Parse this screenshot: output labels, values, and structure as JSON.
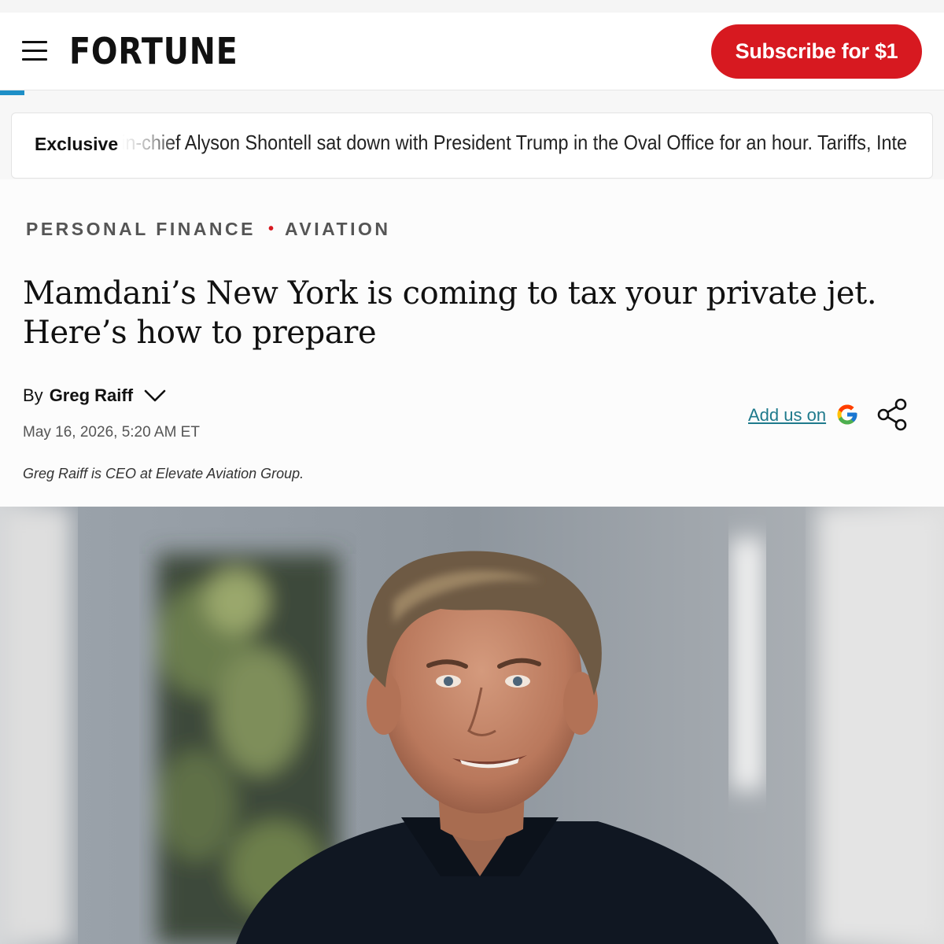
{
  "header": {
    "logo": "FORTUNE",
    "subscribe_label": "Subscribe for $1"
  },
  "ticker": {
    "label": "Exclusive",
    "text": "Editor-in-chief Alyson Shontell sat down with President Trump in the Oval Office for an hour. Tariffs, Inte"
  },
  "article": {
    "categories": [
      "PERSONAL FINANCE",
      "AVIATION"
    ],
    "headline": "Mamdani’s New York is coming to tax your private jet. Here’s how to prepare",
    "byline_prefix": "By",
    "author": "Greg Raiff",
    "date": "May 16, 2026, 5:20 AM ET",
    "bio": "Greg Raiff is CEO at Elevate Aviation Group.",
    "add_us_label": "Add us on"
  },
  "colors": {
    "brand_red": "#d71920",
    "link_teal": "#1f7a8c",
    "progress_blue": "#1e8fc7"
  },
  "icons": [
    "menu-icon",
    "chevron-down-icon",
    "google-icon",
    "share-icon"
  ]
}
